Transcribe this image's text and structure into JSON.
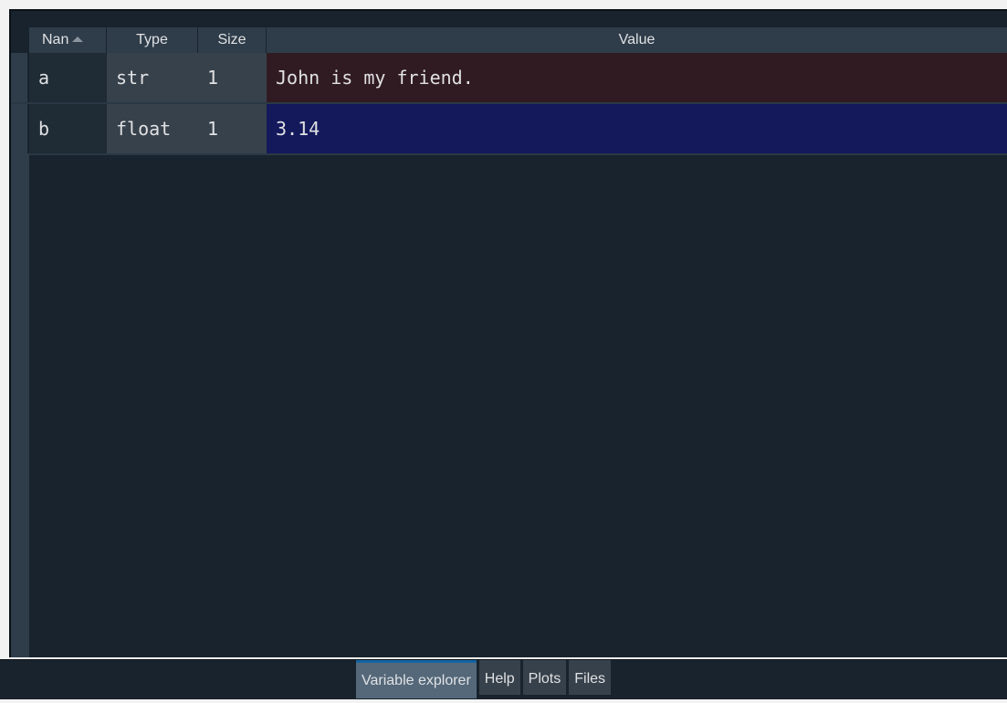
{
  "table": {
    "headers": {
      "name": "Nan",
      "type": "Type",
      "size": "Size",
      "value": "Value"
    },
    "rows": [
      {
        "name": "a",
        "type": "str",
        "size": "1",
        "value": "John is my friend.",
        "value_bg": "#311b22"
      },
      {
        "name": "b",
        "type": "float",
        "size": "1",
        "value": "3.14",
        "value_bg": "#13195b"
      }
    ]
  },
  "tabs": [
    {
      "label": "Variable explorer",
      "active": true
    },
    {
      "label": "Help",
      "active": false
    },
    {
      "label": "Plots",
      "active": false
    },
    {
      "label": "Files",
      "active": false
    }
  ],
  "colors": {
    "pane_bg": "#19232d",
    "header_bg": "#2f3d4a",
    "accent": "#1464a0"
  }
}
